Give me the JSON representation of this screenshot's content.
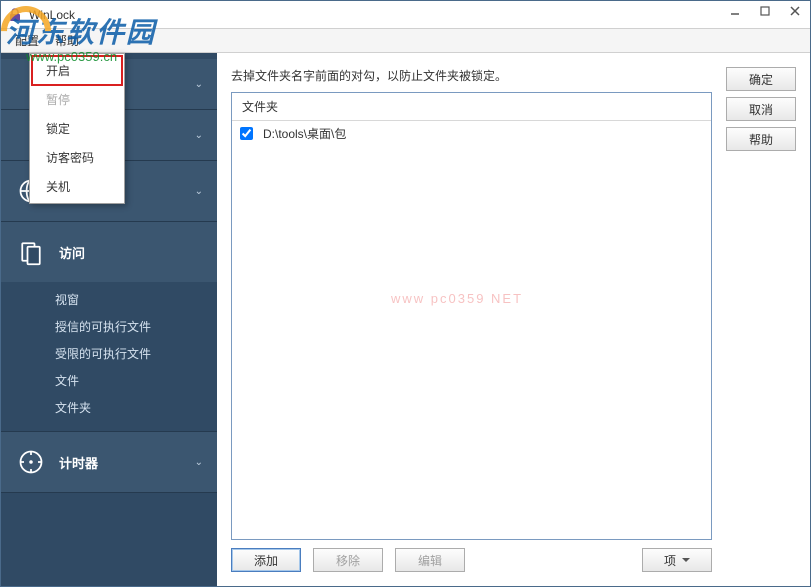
{
  "window": {
    "title": "WinLock"
  },
  "watermark": {
    "brand": "河东软件园",
    "url": "www.pc0359.cn",
    "center": "www pc0359 NET"
  },
  "menubar": {
    "items": [
      "配置",
      "帮助"
    ]
  },
  "context_menu": {
    "items": [
      {
        "label": "开启",
        "highlighted": true,
        "disabled": false
      },
      {
        "label": "暂停",
        "highlighted": false,
        "disabled": true
      },
      {
        "label": "锁定",
        "highlighted": false,
        "disabled": false
      },
      {
        "label": "访客密码",
        "highlighted": false,
        "disabled": false
      },
      {
        "label": "关机",
        "highlighted": false,
        "disabled": false
      }
    ]
  },
  "sidebar": {
    "sections": [
      {
        "label": "",
        "icon": "",
        "expanded": false,
        "subs": []
      },
      {
        "label": "",
        "icon": "",
        "expanded": false,
        "subs": []
      },
      {
        "label": "英特网",
        "icon": "globe",
        "expanded": false,
        "subs": []
      },
      {
        "label": "访问",
        "icon": "folder",
        "expanded": true,
        "subs": [
          "视窗",
          "授信的可执行文件",
          "受限的可执行文件",
          "文件",
          "文件夹"
        ]
      },
      {
        "label": "计时器",
        "icon": "compass",
        "expanded": false,
        "subs": []
      }
    ]
  },
  "main": {
    "instruction": "去掉文件夹名字前面的对勾，以防止文件夹被锁定。",
    "list_header": "文件夹",
    "rows": [
      {
        "checked": true,
        "path": "D:\\tools\\桌面\\包"
      }
    ],
    "buttons": {
      "add": "添加",
      "remove": "移除",
      "edit": "编辑",
      "options": "项"
    }
  },
  "right_buttons": {
    "ok": "确定",
    "cancel": "取消",
    "help": "帮助"
  }
}
